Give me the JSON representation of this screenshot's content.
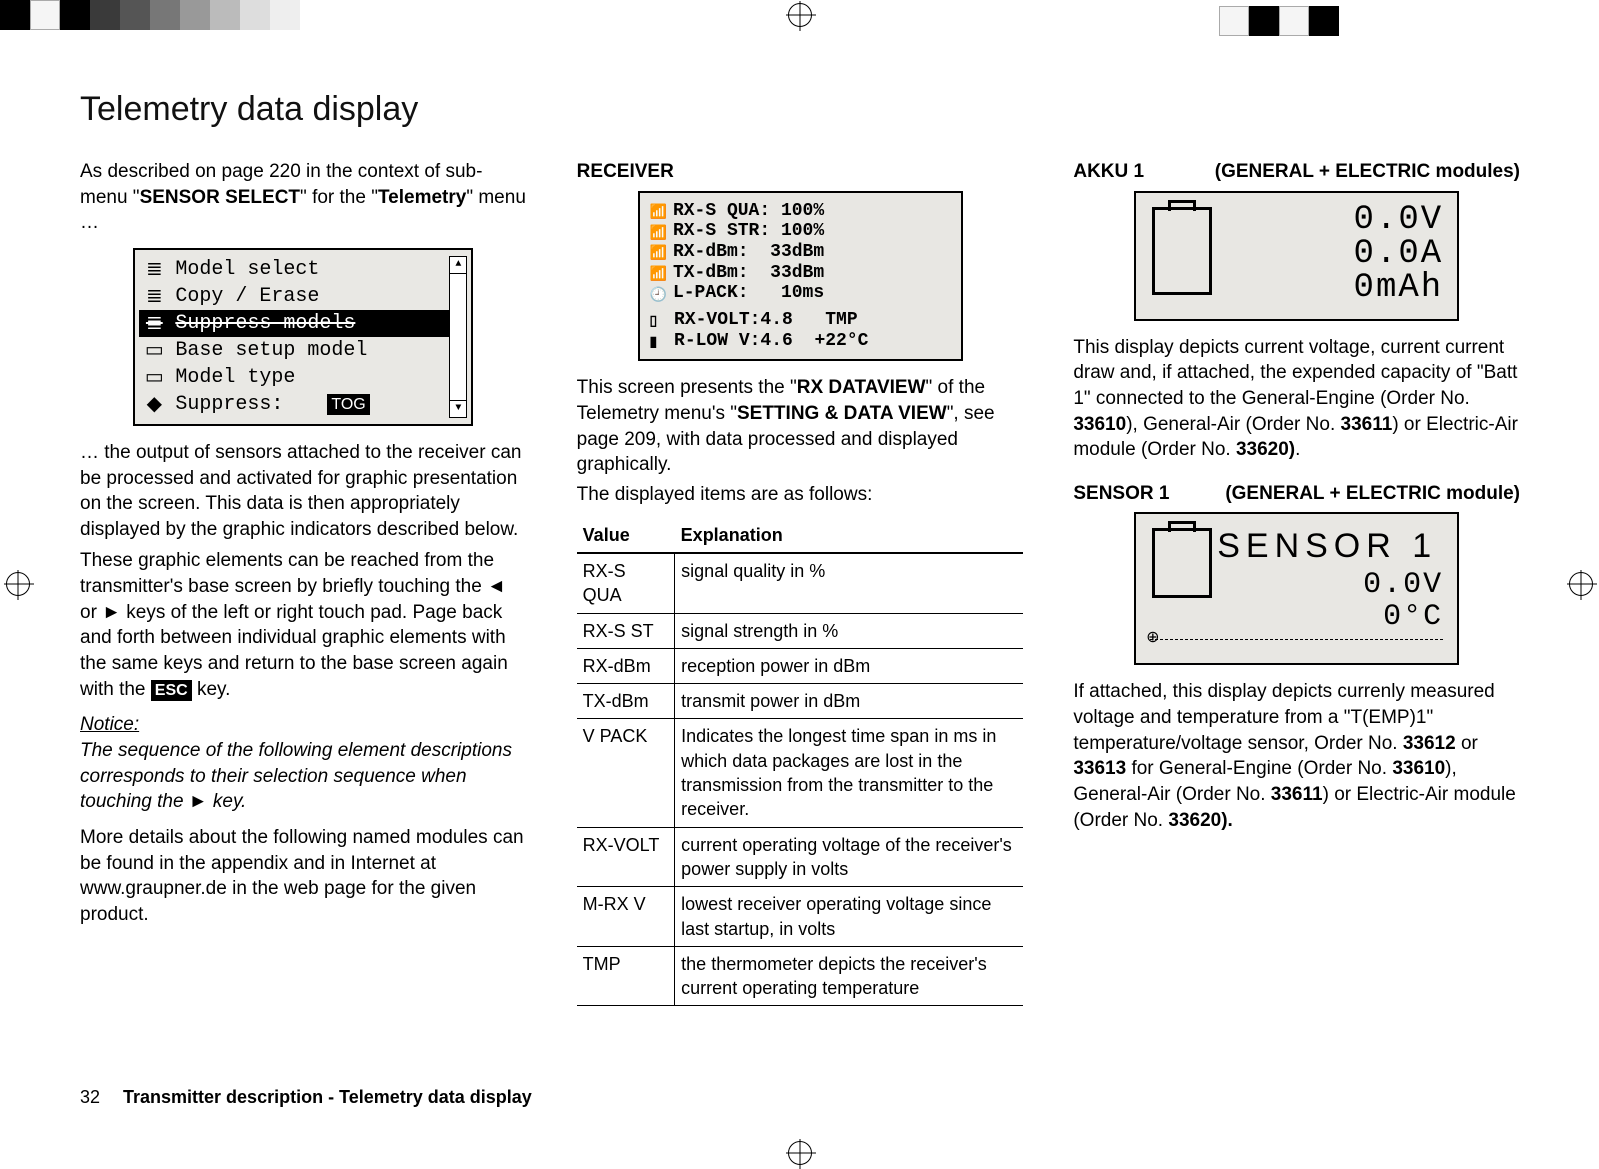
{
  "page": {
    "number": "32",
    "footer_title": "Transmitter description - Telemetry data display",
    "section_heading": "Telemetry data display"
  },
  "col1": {
    "intro_prefix": "As described on page 220 in the context of sub-menu \"",
    "intro_bold1": "SENSOR SELECT",
    "intro_mid": "\" for the \"",
    "intro_bold2": "Telemetry",
    "intro_suffix": "\" menu …",
    "menu": {
      "items": [
        {
          "icon": "≣",
          "label": "Model select"
        },
        {
          "icon": "≣",
          "label": "Copy / Erase"
        },
        {
          "icon": "≣",
          "label": "Suppress models",
          "inverted": true
        },
        {
          "icon": "▭",
          "label": "Base setup model"
        },
        {
          "icon": "▭",
          "label": "Model type"
        },
        {
          "icon": "◆",
          "label": "Suppress:",
          "badge": "TOG"
        }
      ]
    },
    "p2": "… the output of sensors attached to the receiver can be processed and activated for graphic presentation on the screen. This data is then appropriately displayed by the graphic indicators described below.",
    "p3_a": "These graphic elements can be reached from the transmitter's base screen by briefly touching the ◄ or ► keys of the left or right touch pad. Page back and forth between individual graphic elements with the same keys and return to the base screen again with the ",
    "p3_esc": "ESC",
    "p3_b": " key.",
    "notice_h": "Notice:",
    "notice_body": "The sequence of the following element descriptions corresponds to their selection sequence when touching the ► key.",
    "p4": "More details about the following named modules can be found in the appendix and in Internet at www.graupner.de in the web page for the given product."
  },
  "receiver": {
    "title": "RECEIVER",
    "lcd": {
      "l1": "RX-S QUA: 100%",
      "l2": "RX-S STR: 100%",
      "l3": "RX-dBm:  33dBm",
      "l4": "TX-dBm:  33dBm",
      "l5": "L-PACK:   10ms",
      "l6": " RX-VOLT:4.8   TMP",
      "l7": " R-LOW V:4.6  +22°C"
    },
    "desc1_a": "This screen presents the \"",
    "desc1_b1": "RX DATAVIEW",
    "desc1_b": "\" of the Telemetry menu's \"",
    "desc1_b2": "SETTING & DATA VIEW",
    "desc1_c": "\", see page 209, with data processed and displayed graphically.",
    "desc2": "The displayed items are as follows:",
    "table": {
      "head_value": "Value",
      "head_expl": "Explanation",
      "rows": [
        {
          "v": "RX-S QUA",
          "e": "signal quality in %"
        },
        {
          "v": "RX-S ST",
          "e": "signal strength in %"
        },
        {
          "v": "RX-dBm",
          "e": "reception power in dBm"
        },
        {
          "v": "TX-dBm",
          "e": "transmit power in dBm"
        },
        {
          "v": "V PACK",
          "e": "Indicates the longest time span in ms in which data packages are lost in the transmission from the transmitter to the receiver."
        },
        {
          "v": "RX-VOLT",
          "e": "current operating voltage of the receiver's power supply in volts"
        },
        {
          "v": "M-RX V",
          "e": "lowest receiver operating voltage since last startup, in volts"
        },
        {
          "v": "TMP",
          "e": "the thermometer depicts the receiver's current operating temperature"
        }
      ]
    }
  },
  "akku": {
    "title": "AKKU 1",
    "subtitle": "(GENERAL + ELECTRIC modules)",
    "vals": {
      "v": "0.0V",
      "a": "0.0A",
      "mah": "0mAh"
    },
    "desc_a": "This display depicts current voltage, current current draw and, if attached, the expended capacity of \"Batt 1\" connected to the General-Engine (Order No. ",
    "b1": "33610",
    "desc_b": "), General-Air (Order No. ",
    "b2": "33611",
    "desc_c": ") or Electric-Air module (Order No. ",
    "b3": "33620)",
    "desc_d": "."
  },
  "sensor": {
    "title": "SENSOR 1",
    "subtitle": "(GENERAL + ELECTRIC module)",
    "heading": "SENSOR  1",
    "vals": {
      "v": "0.0V",
      "t": "0°C"
    },
    "desc_a": "If attached, this display depicts currenly measured voltage and temperature from a \"T(EMP)1\" temperature/voltage sensor, Order No. ",
    "b1": "33612",
    "desc_b": " or ",
    "b2": "33613",
    "desc_c": " for General-Engine (Order No. ",
    "b3": "33610",
    "desc_d": "), General-Air (Order No. ",
    "b4": "33611",
    "desc_e": ") or Electric-Air module (Order No. ",
    "b5": "33620).",
    "desc_f": ""
  }
}
